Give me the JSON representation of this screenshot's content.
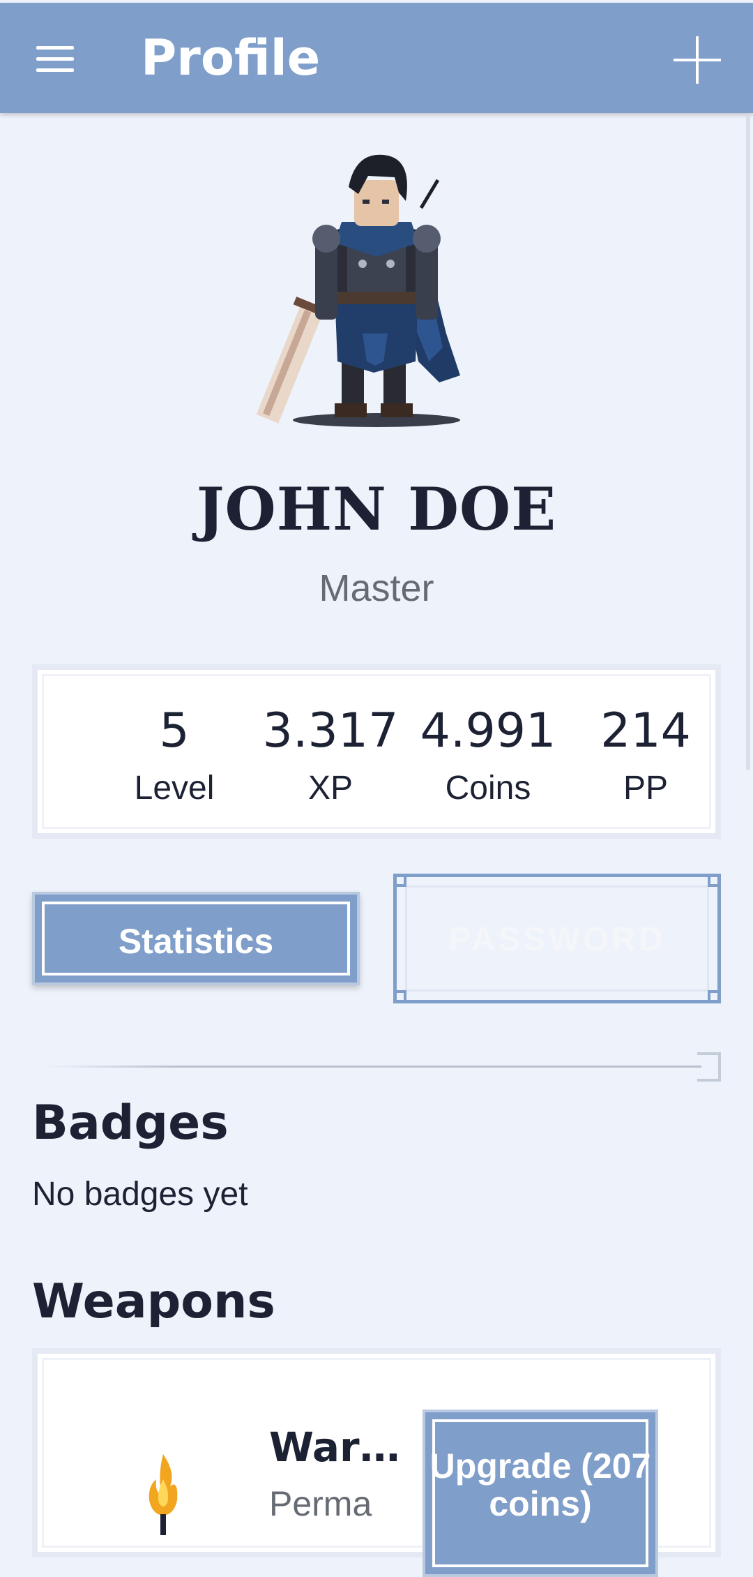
{
  "appbar": {
    "title": "Profile",
    "menu_icon": "menu-icon",
    "action_icon": "plus-icon"
  },
  "profile": {
    "name": "JOHN DOE",
    "rank": "Master"
  },
  "stats": [
    {
      "value": "5",
      "label": "Level"
    },
    {
      "value": "3.317",
      "label": "XP"
    },
    {
      "value": "4.991",
      "label": "Coins"
    },
    {
      "value": "214",
      "label": "PP"
    }
  ],
  "actions": {
    "statistics": "Statistics",
    "password": "PASSWORD"
  },
  "badges": {
    "title": "Badges",
    "empty_text": "No badges yet"
  },
  "weapons": {
    "title": "Weapons",
    "items": [
      {
        "name": "Warri…",
        "subtitle": "Perma",
        "upgrade_label": "Upgrade (207 coins)"
      }
    ]
  },
  "colors": {
    "primary": "#7f9ec9",
    "background": "#eef2fa",
    "text": "#1c2233",
    "muted": "#666a72"
  }
}
